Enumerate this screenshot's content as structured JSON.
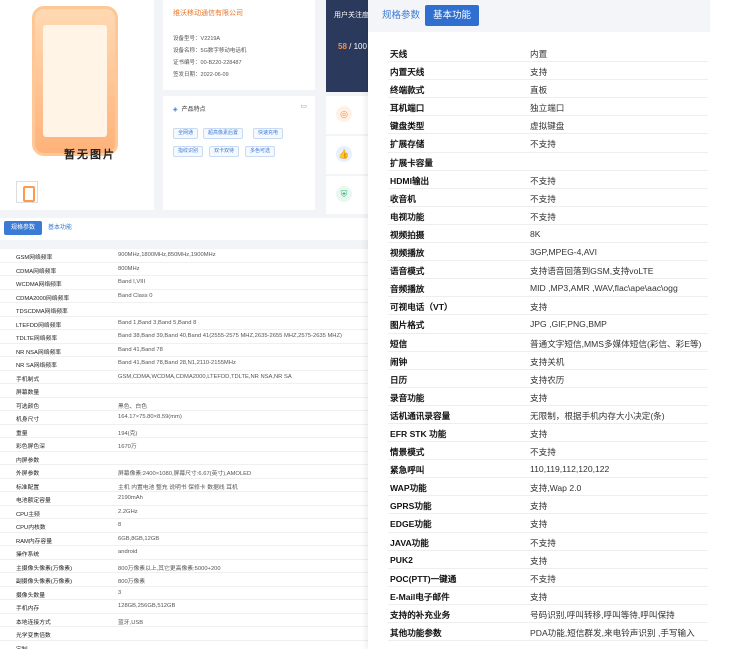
{
  "background": {
    "no_image_text": "暂无图片",
    "company": "维沃移动通信有限公司",
    "info": [
      {
        "label": "设备型号",
        "value": "V2219A"
      },
      {
        "label": "设备名称",
        "value": "5G数字移动电话机"
      },
      {
        "label": "证书编号",
        "value": "00-B220-228487"
      },
      {
        "label": "签发日期",
        "value": "2022-06-09"
      }
    ],
    "features_title": "产品特点",
    "feature_tags": [
      "全网通",
      "超高像素后置",
      "快速充电",
      "指纹识别",
      "双卡双待",
      "多色可选"
    ],
    "side_title": "用户关注度",
    "side_score": "58",
    "side_total": "/ 100",
    "tabs": {
      "active": "规格参数",
      "inactive": "基本功能"
    },
    "rows": [
      {
        "label": "GSM网络频率",
        "value": "900MHz,1800MHz,850MHz,1900MHz"
      },
      {
        "label": "CDMA网络频率",
        "value": "800MHz"
      },
      {
        "label": "WCDMA网络频率",
        "value": "Band I,VIII"
      },
      {
        "label": "CDMA2000网络频率",
        "value": "Band Class 0"
      },
      {
        "label": "TDSCDMA网络频率",
        "value": ""
      },
      {
        "label": "LTEFDD网络频率",
        "value": "Band 1,Band 3,Band 5,Band 8"
      },
      {
        "label": "TDLTE网络频率",
        "value": "Band 38,Band 39,Band 40,Band 41(2555-2575 MHZ,2635-2655 MHZ,2575-2635 MHZ)"
      },
      {
        "label": "NR NSA网络频率",
        "value": "Band 41,Band 78"
      },
      {
        "label": "NR SA网络频率",
        "value": "Band 41,Band 78,Band 28,N1,2110-2155MHz"
      },
      {
        "label": "手机制式",
        "value": "GSM,CDMA,WCDMA,CDMA2000,LTEFDD,TDLTE,NR NSA,NR SA"
      },
      {
        "label": "屏幕数量",
        "value": ""
      },
      {
        "label": "可选颜色",
        "value": "黑色、白色"
      },
      {
        "label": "机身尺寸",
        "value": "164.17×75.80×8.59(mm)"
      },
      {
        "label": "重量",
        "value": "194(克)"
      },
      {
        "label": "彩色屏色深",
        "value": "1670万"
      },
      {
        "label": "内屏参数",
        "value": ""
      },
      {
        "label": "外屏参数",
        "value": "屏幕像素:2400×1080,屏幕尺寸:6.67(英寸),AMOLED"
      },
      {
        "label": "标准配置",
        "value": "主机 内置电池 整充 说明书 保修卡 数据线 耳机"
      },
      {
        "label": "电池额定容量",
        "value": "2190mAh"
      },
      {
        "label": "CPU主频",
        "value": "2.2GHz"
      },
      {
        "label": "CPU内核数",
        "value": "8"
      },
      {
        "label": "RAM内存容量",
        "value": "6GB,8GB,12GB"
      },
      {
        "label": "操作系统",
        "value": "android"
      },
      {
        "label": "主摄像头像素(万像素)",
        "value": "800万像素以上,其它更高像素:5000+200"
      },
      {
        "label": "副摄像头像素(万像素)",
        "value": "800万像素"
      },
      {
        "label": "摄像头数量",
        "value": "3"
      },
      {
        "label": "手机内存",
        "value": "128GB,256GB,512GB"
      },
      {
        "label": "本地连接方式",
        "value": "蓝牙,USB"
      },
      {
        "label": "光学变焦倍数",
        "value": ""
      },
      {
        "label": "定制",
        "value": ""
      }
    ]
  },
  "panel": {
    "tabs": {
      "inactive": "规格参数",
      "active": "基本功能"
    },
    "rows": [
      {
        "label": "天线",
        "value": "内置"
      },
      {
        "label": "内置天线",
        "value": "支持"
      },
      {
        "label": "终端款式",
        "value": "直板"
      },
      {
        "label": "耳机端口",
        "value": "独立端口"
      },
      {
        "label": "键盘类型",
        "value": "虚拟键盘"
      },
      {
        "label": "扩展存储",
        "value": "不支持"
      },
      {
        "label": "扩展卡容量",
        "value": ""
      },
      {
        "label": "HDMI输出",
        "value": "不支持"
      },
      {
        "label": "收音机",
        "value": "不支持"
      },
      {
        "label": "电视功能",
        "value": "不支持"
      },
      {
        "label": "视频拍摄",
        "value": "8K"
      },
      {
        "label": "视频播放",
        "value": "3GP,MPEG-4,AVI"
      },
      {
        "label": "语音模式",
        "value": "支持语音回落到GSM,支持voLTE"
      },
      {
        "label": "音频播放",
        "value": "MID ,MP3,AMR ,WAV,flac\\ape\\aac\\ogg"
      },
      {
        "label": "可视电话（VT）",
        "value": "支持"
      },
      {
        "label": "图片格式",
        "value": "JPG ,GIF,PNG,BMP"
      },
      {
        "label": "短信",
        "value": "普通文字短信,MMS多媒体短信(彩信、彩E等)"
      },
      {
        "label": "闹钟",
        "value": "支持关机"
      },
      {
        "label": "日历",
        "value": "支持农历"
      },
      {
        "label": "录音功能",
        "value": "支持"
      },
      {
        "label": "话机通讯录容量",
        "value": "无限制，根据手机内存大小决定(条)"
      },
      {
        "label": "EFR STK 功能",
        "value": "支持"
      },
      {
        "label": "情景模式",
        "value": "不支持"
      },
      {
        "label": "紧急呼叫",
        "value": "110,119,112,120,122"
      },
      {
        "label": "WAP功能",
        "value": "支持,Wap 2.0"
      },
      {
        "label": "GPRS功能",
        "value": "支持"
      },
      {
        "label": "EDGE功能",
        "value": "支持"
      },
      {
        "label": "JAVA功能",
        "value": "不支持"
      },
      {
        "label": "PUK2",
        "value": "支持"
      },
      {
        "label": "POC(PTT)一键通",
        "value": "不支持"
      },
      {
        "label": "E-Mail电子邮件",
        "value": "支持"
      },
      {
        "label": "支持的补充业务",
        "value": "号码识别,呼叫转移,呼叫等待,呼叫保持"
      },
      {
        "label": "其他功能参数",
        "value": "PDA功能,短信群发,来电铃声识别 ,手写输入"
      }
    ]
  }
}
